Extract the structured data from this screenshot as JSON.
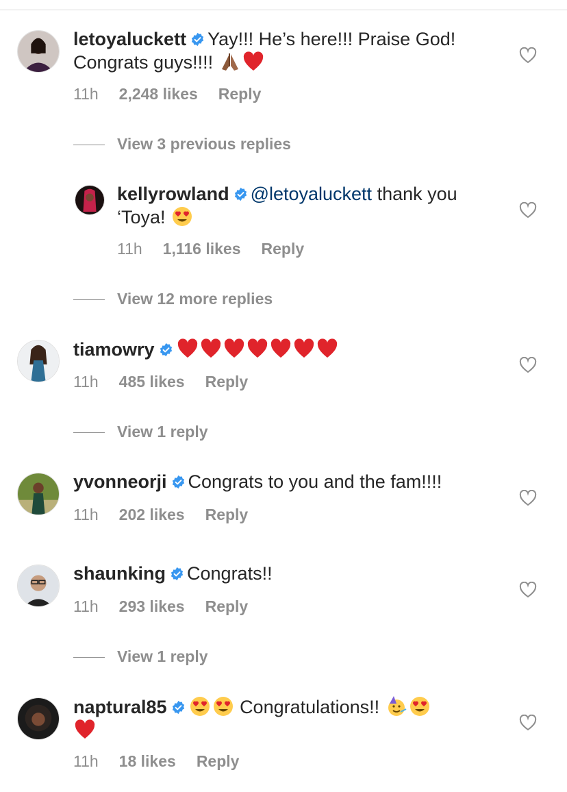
{
  "comments": [
    {
      "username": "letoyaluckett",
      "text_line1": "Yay!!! He’s here!!! Praise God!",
      "text_line2": "Congrats guys!!!!",
      "time": "11h",
      "likes": "2,248 likes",
      "reply": "Reply"
    },
    {
      "username": "kellyrowland",
      "mention": "@letoyaluckett",
      "text_line1": "thank you",
      "text_line2": "‘Toya!",
      "time": "11h",
      "likes": "1,116 likes",
      "reply": "Reply"
    },
    {
      "username": "tiamowry",
      "time": "11h",
      "likes": "485 likes",
      "reply": "Reply"
    },
    {
      "username": "yvonneorji",
      "text_line1": "Congrats to you and the fam!!!!",
      "time": "11h",
      "likes": "202 likes",
      "reply": "Reply"
    },
    {
      "username": "shaunking",
      "text_line1": "Congrats!!",
      "time": "11h",
      "likes": "293 likes",
      "reply": "Reply"
    },
    {
      "username": "naptural85",
      "text_line1": "Congratulations!!",
      "time": "11h",
      "likes": "18 likes",
      "reply": "Reply"
    }
  ],
  "view_links": {
    "letoya_previous": "View 3 previous replies",
    "kelly_more": "View 12 more replies",
    "tiamowry_reply": "View 1 reply",
    "shaunking_reply": "View 1 reply"
  },
  "icons": {
    "verified": "verified-badge-icon",
    "like": "heart-outline-icon"
  },
  "colors": {
    "verified": "#3897f0",
    "mention": "#00376b",
    "muted": "#8e8e8e",
    "text": "#262626",
    "red_heart": "#e0242b"
  }
}
